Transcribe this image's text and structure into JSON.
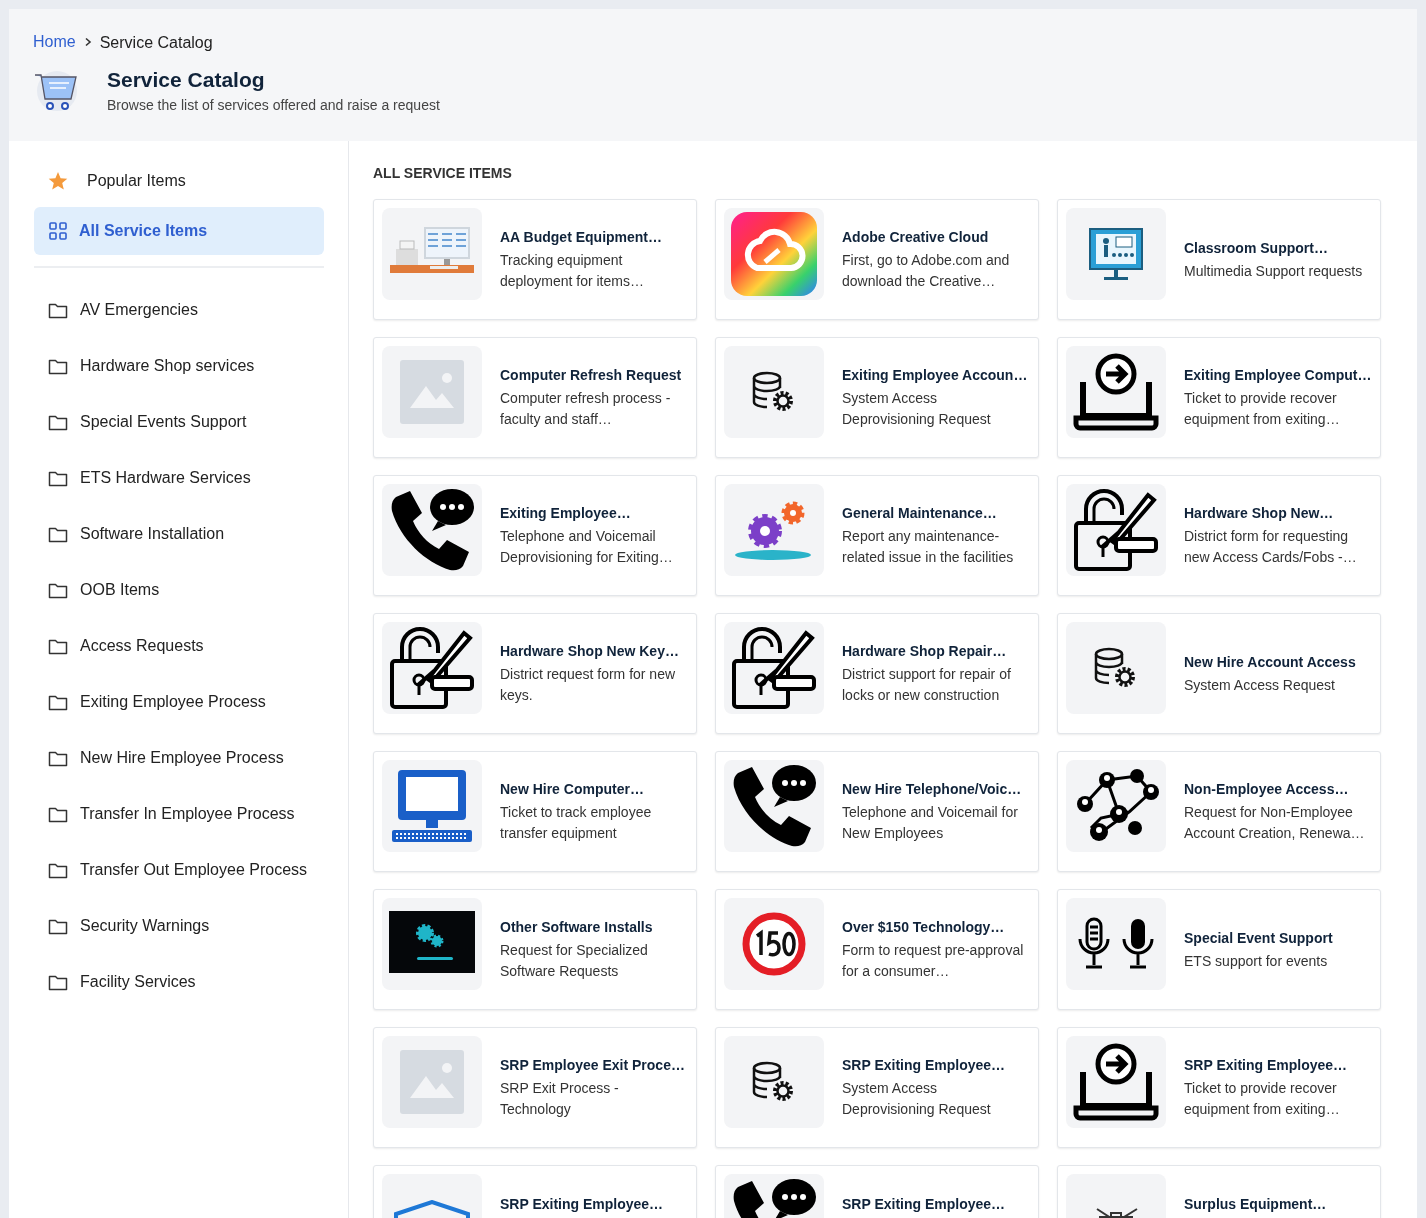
{
  "breadcrumb": [
    {
      "label": "Home",
      "kind": "link"
    },
    {
      "label": "Service Catalog",
      "kind": "current"
    }
  ],
  "header": {
    "title": "Service Catalog",
    "subtitle": "Browse the list of services offered and raise a request"
  },
  "sidebar": {
    "views": [
      {
        "label": "Popular Items",
        "kind": "star",
        "selected": false
      },
      {
        "label": "All Service Items",
        "kind": "grid",
        "selected": true
      }
    ],
    "categories": [
      {
        "label": "AV Emergencies",
        "selected": false
      },
      {
        "label": "Hardware Shop services",
        "selected": false
      },
      {
        "label": "Special Events Support",
        "selected": false
      },
      {
        "label": "ETS Hardware Services",
        "selected": false
      },
      {
        "label": "Software Installation",
        "selected": false
      },
      {
        "label": "OOB Items",
        "selected": false
      },
      {
        "label": "Access Requests",
        "selected": false
      },
      {
        "label": "Exiting Employee Process",
        "selected": false
      },
      {
        "label": "New Hire Employee Process",
        "selected": false
      },
      {
        "label": "Transfer In Employee Process",
        "selected": false
      },
      {
        "label": "Transfer Out Employee Process",
        "selected": false
      },
      {
        "label": "Security Warnings",
        "selected": false
      },
      {
        "label": "Facility Services",
        "selected": false
      }
    ]
  },
  "main": {
    "heading": "ALL SERVICE ITEMS",
    "items": [
      {
        "title": "AA Budget Equipment…",
        "description": "Tracking equipment deployment for items…",
        "kind": "equipment"
      },
      {
        "title": "Adobe Creative Cloud",
        "description": "First, go to Adobe.com and download the Creative…",
        "kind": "rainbow-app"
      },
      {
        "title": "Classroom Support…",
        "description": "Multimedia Support requests",
        "kind": "classroom"
      },
      {
        "title": "Computer Refresh Request",
        "description": "Computer refresh process - faculty and staff…",
        "kind": "placeholder"
      },
      {
        "title": "Exiting Employee Accoun…",
        "description": "System Access Deprovisioning Request",
        "kind": "database"
      },
      {
        "title": "Exiting Employee Comput…",
        "description": "Ticket to provide recover equipment from exiting…",
        "kind": "laptop"
      },
      {
        "title": "Exiting Employee…",
        "description": "Telephone and Voicemail Deprovisioning for Exiting…",
        "kind": "phone"
      },
      {
        "title": "General Maintenance…",
        "description": "Report any maintenance-related issue in the facilities",
        "kind": "gears"
      },
      {
        "title": "Hardware Shop New…",
        "description": "District form for requesting new Access Cards/Fobs -…",
        "kind": "lock"
      },
      {
        "title": "Hardware Shop New Key…",
        "description": "District request form for new keys.",
        "kind": "lock"
      },
      {
        "title": "Hardware Shop Repair…",
        "description": "District support for repair of locks or new construction",
        "kind": "lock"
      },
      {
        "title": "New Hire Account Access",
        "description": "System Access Request",
        "kind": "database"
      },
      {
        "title": "New Hire Computer…",
        "description": "Ticket to track employee transfer equipment",
        "kind": "desktop"
      },
      {
        "title": "New Hire Telephone/Voic…",
        "description": "Telephone and Voicemail for New Employees",
        "kind": "phone"
      },
      {
        "title": "Non-Employee Access…",
        "description": "Request for Non-Employee Account Creation, Renewa…",
        "kind": "network"
      },
      {
        "title": "Other Software Installs",
        "description": "Request for Specialized Software Requests",
        "kind": "screen"
      },
      {
        "title": "Over $150 Technology…",
        "description": "Form to request pre-approval for a consumer…",
        "kind": "sign"
      },
      {
        "title": "Special Event Support",
        "description": "ETS support for events",
        "kind": "mics"
      },
      {
        "title": "SRP Employee Exit Proce…",
        "description": "SRP Exit Process - Technology",
        "kind": "placeholder"
      },
      {
        "title": "SRP Exiting Employee…",
        "description": "System Access Deprovisioning Request",
        "kind": "database"
      },
      {
        "title": "SRP Exiting Employee…",
        "description": "Ticket to provide recover equipment from exiting…",
        "kind": "laptop"
      },
      {
        "title": "SRP Exiting Employee…",
        "kind": "email"
      },
      {
        "title": "SRP Exiting Employee…",
        "kind": "phone"
      },
      {
        "title": "Surplus Equipment…",
        "kind": "bin"
      }
    ]
  }
}
